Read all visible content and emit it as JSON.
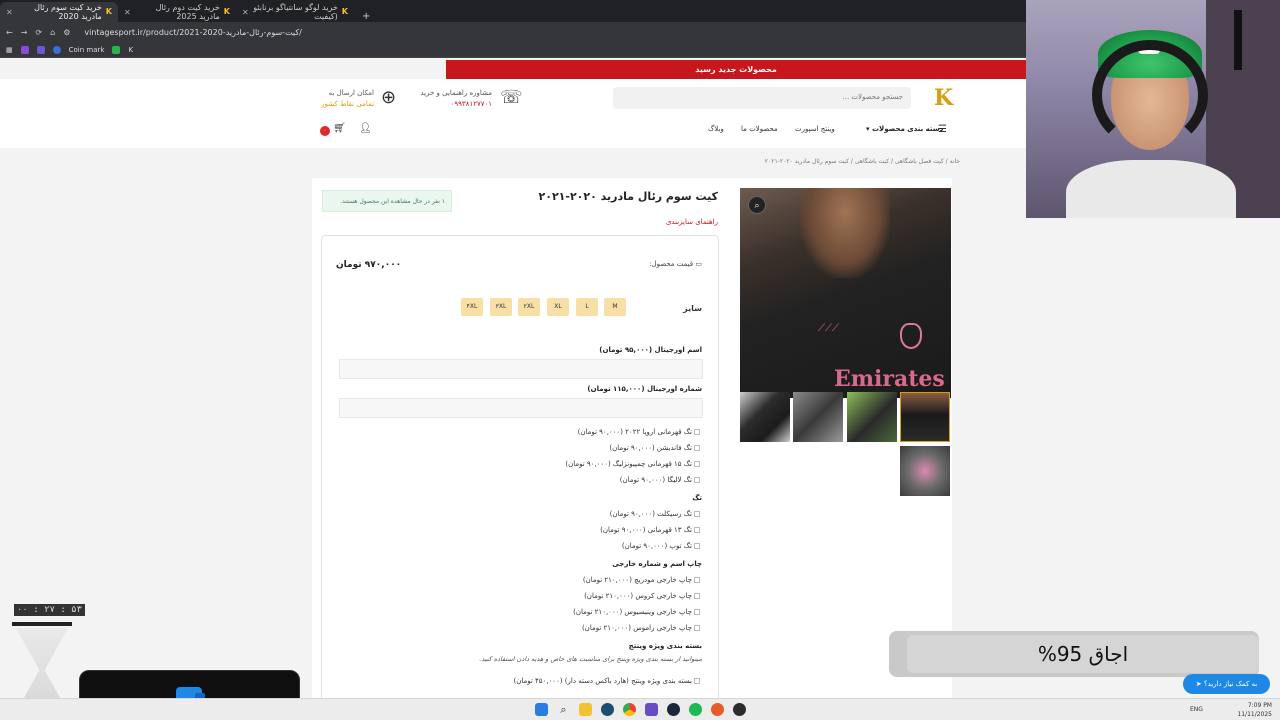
{
  "browser": {
    "tabs": [
      {
        "title": "خرید کیت سوم رئال مادرید 2020",
        "active": true
      },
      {
        "title": "خرید کیت دوم رئال مادرید 2025",
        "active": false
      },
      {
        "title": "خرید لوگو سانتیاگو برنابئو (کیفیت",
        "active": false
      }
    ],
    "new_tab": "+",
    "url": "vintagesport.ir/product/2021-2020-کیت-سوم-رئال-مادرید/",
    "bookmarks": [
      "Coin mark",
      "K"
    ]
  },
  "site": {
    "promo": "محصولات جدید رسید",
    "search_placeholder": "جستجو محصولات ...",
    "consult": {
      "line1": "مشاوره راهنمایی و خرید",
      "phone": "۰۹۹۳۸۱۲۷۷۰۱"
    },
    "shipping": {
      "line1": "امکان ارسال به",
      "line2": "تمامی نقاط کشور"
    },
    "nav": {
      "categories": "دسته بندی محصولات",
      "vintage": "وینتج اسپورت",
      "products": "محصولات ما",
      "blog": "وبلاگ"
    },
    "cart_count": "۰",
    "breadcrumb": "خانه / کیت فصل باشگاهی / کیت باشگاهی / کیت سوم رئال مادرید ۲۰۲۰-۲۰۲۱",
    "product": {
      "title": "کیت سوم رئال مادرید ۲۰۲۰-۲۰۲۱",
      "size_guide": "راهنمای سایزبندی",
      "viewing": "۱ نفر در حال مشاهده این محصول هستند.",
      "price_label": "قیمت محصول:",
      "price": "۹۷۰,۰۰۰ تومان",
      "size_label": "سایز",
      "sizes": [
        "M",
        "L",
        "XL",
        "۲XL",
        "۳XL",
        "۴XL"
      ],
      "sponsor_text": "Emirates"
    },
    "options": {
      "name_head": "اسم اورجینال (۹۵,۰۰۰ تومان)",
      "number_head": "شماره اورجینال (۱۱۵,۰۰۰ تومان)",
      "badges": [
        "تگ قهرمانی اروپا ۲۰۲۲ (۹۰,۰۰۰ تومان)",
        "تگ فاندیشن (۹۰,۰۰۰ تومان)",
        "تگ ۱۵ قهرمانی چمپیونزلیگ (۹۰,۰۰۰ تومان)",
        "تگ لالیگا (۹۰,۰۰۰ تومان)"
      ],
      "tag_head": "تگ",
      "tags": [
        "تگ رسیکلت (۹۰,۰۰۰ تومان)",
        "تگ ۱۳ قهرمانی (۹۰,۰۰۰ تومان)",
        "تگ توپ (۹۰,۰۰۰ تومان)"
      ],
      "print_head": "چاپ اسم و شماره خارجی",
      "prints": [
        "چاپ خارجی مودریچ (۲۱۰,۰۰۰ تومان)",
        "چاپ خارجی کروس (۲۱۰,۰۰۰ تومان)",
        "چاپ خارجی وینیسیوس (۲۱۰,۰۰۰ تومان)",
        "چاپ خارجی راموس (۲۱۰,۰۰۰ تومان)"
      ],
      "package_head": "بسته بندی ویژه وینتج",
      "package_note": "میتوانید از بسته بندی ویژه وینتج برای مناسبت های خاص و هدیه دادن استفاده کنید.",
      "package_option": "بسته بندی ویژه وینتج (هارد باکس دسته دار) (۴۵۰,۰۰۰ تومان)"
    },
    "help_button": "به کمک نیاز دارید؟"
  },
  "overlay": {
    "battery": "اجاق 95%",
    "timer": "۰۰ : ۲۷ : ۵۳"
  },
  "taskbar": {
    "lang": "ENG",
    "time": "7:09 PM",
    "date": "11/11/2025"
  },
  "colors": {
    "brand_red": "#c8161d",
    "brand_gold": "#d4a017",
    "size_chip": "#f7dfa6",
    "help_blue": "#1e88e5"
  }
}
